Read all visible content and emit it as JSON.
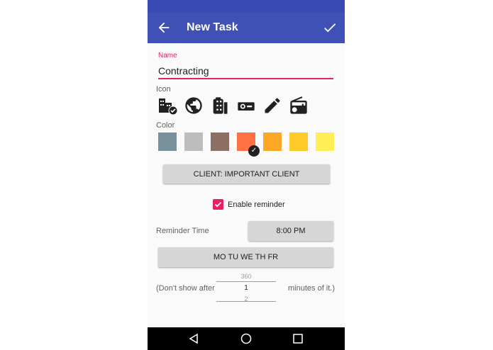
{
  "appbar": {
    "title": "New Task",
    "back_icon": "arrow-left-icon",
    "save_icon": "check-icon"
  },
  "name": {
    "label": "Name",
    "value": "Contracting"
  },
  "icon_section": {
    "label": "Icon",
    "icons": [
      "office-building-icon",
      "globe-icon",
      "film-strip-icon",
      "projector-icon",
      "pencil-icon",
      "radio-icon"
    ],
    "selected_index": 0
  },
  "color_section": {
    "label": "Color",
    "colors": [
      "#78909c",
      "#bdbdbd",
      "#8d6e63",
      "#ff7043",
      "#ffa726",
      "#ffca28",
      "#ffee58"
    ],
    "selected_index": 3
  },
  "client_button": {
    "label": "CLIENT: IMPORTANT CLIENT"
  },
  "reminder": {
    "label": "Enable reminder",
    "checked": true
  },
  "reminder_time": {
    "label": "Reminder Time",
    "value": "8:00 PM"
  },
  "days": {
    "label": "MO TU WE TH FR"
  },
  "dont_show": {
    "prefix": "(Don't show after",
    "suffix": "minutes of it.)",
    "picker_prev": "360",
    "picker_current": "1",
    "picker_next": "2"
  },
  "theme": {
    "primary": "#3f51b5",
    "accent": "#e91e63"
  }
}
